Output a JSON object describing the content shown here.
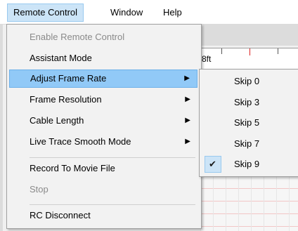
{
  "menubar": {
    "items": [
      {
        "label": "Remote Control",
        "active": true
      },
      {
        "label": "Window",
        "active": false
      },
      {
        "label": "Help",
        "active": false
      }
    ]
  },
  "background": {
    "ruler_label": "8ft"
  },
  "menu": {
    "items": [
      {
        "label": "Enable Remote Control",
        "disabled": true,
        "submenu": false
      },
      {
        "label": "Assistant Mode",
        "disabled": false,
        "submenu": false
      },
      {
        "label": "Adjust Frame Rate",
        "disabled": false,
        "submenu": true,
        "highlighted": true
      },
      {
        "label": "Frame Resolution",
        "disabled": false,
        "submenu": true
      },
      {
        "label": "Cable Length",
        "disabled": false,
        "submenu": true
      },
      {
        "label": "Live Trace Smooth Mode",
        "disabled": false,
        "submenu": true
      },
      {
        "label": "Record To Movie File",
        "disabled": false,
        "submenu": false
      },
      {
        "label": "Stop",
        "disabled": true,
        "submenu": false
      },
      {
        "label": "RC Disconnect",
        "disabled": false,
        "submenu": false
      }
    ],
    "arrow_glyph": "▶"
  },
  "submenu": {
    "items": [
      {
        "label": "Skip 0",
        "checked": false
      },
      {
        "label": "Skip 3",
        "checked": false
      },
      {
        "label": "Skip 5",
        "checked": false
      },
      {
        "label": "Skip 7",
        "checked": false
      },
      {
        "label": "Skip 9",
        "checked": true
      }
    ],
    "check_glyph": "✔"
  },
  "colors": {
    "menu_bg": "#f2f2f2",
    "highlight_bg": "#91c9f7",
    "active_menubar_bg": "#cce4f7",
    "disabled_text": "#8a8a8a"
  }
}
